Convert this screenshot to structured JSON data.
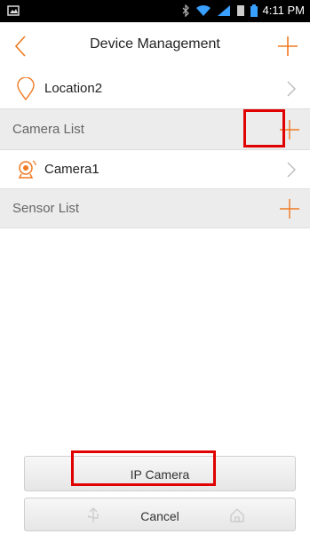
{
  "status_bar": {
    "time": "4:11 PM"
  },
  "header": {
    "title": "Device Management"
  },
  "location": {
    "label": "Location2"
  },
  "camera_section": {
    "label": "Camera List"
  },
  "camera_item": {
    "label": "Camera1"
  },
  "sensor_section": {
    "label": "Sensor List"
  },
  "action_sheet": {
    "ip_camera_label": "IP Camera",
    "cancel_label": "Cancel"
  },
  "colors": {
    "accent": "#f07a21",
    "section_bg": "#ececec",
    "highlight": "#e00000"
  }
}
